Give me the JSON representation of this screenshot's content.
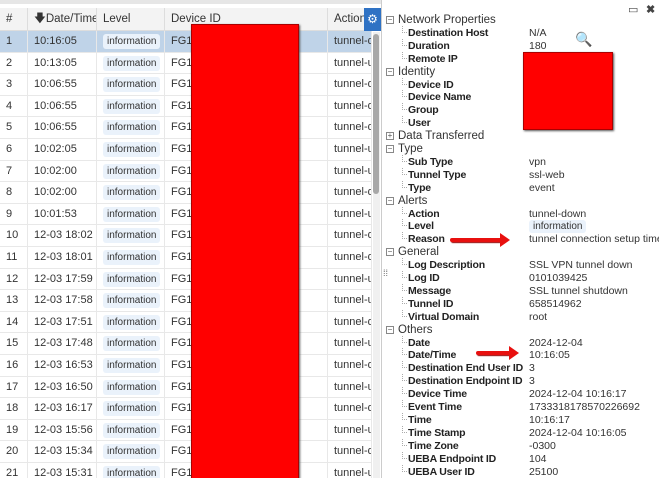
{
  "table": {
    "columns": [
      "#",
      "Date/Time",
      "Level",
      "Device ID",
      "Action"
    ],
    "sort_icon": "arrow-down-icon",
    "settings_icon": "gear-icon",
    "rows": [
      {
        "n": "1",
        "time": "10:16:05",
        "level": "information",
        "device": "FG1K",
        "action": "tunnel-down"
      },
      {
        "n": "2",
        "time": "10:13:05",
        "level": "information",
        "device": "FG1K",
        "action": "tunnel-up"
      },
      {
        "n": "3",
        "time": "10:06:55",
        "level": "information",
        "device": "FG1K",
        "action": "tunnel-down"
      },
      {
        "n": "4",
        "time": "10:06:55",
        "level": "information",
        "device": "FG1K",
        "action": "tunnel-down"
      },
      {
        "n": "5",
        "time": "10:06:55",
        "level": "information",
        "device": "FG1K",
        "action": "tunnel-down"
      },
      {
        "n": "6",
        "time": "10:02:05",
        "level": "information",
        "device": "FG1K",
        "action": "tunnel-up"
      },
      {
        "n": "7",
        "time": "10:02:00",
        "level": "information",
        "device": "FG1K",
        "action": "tunnel-up"
      },
      {
        "n": "8",
        "time": "10:02:00",
        "level": "information",
        "device": "FG1K",
        "action": "tunnel-down"
      },
      {
        "n": "9",
        "time": "10:01:53",
        "level": "information",
        "device": "FG1K",
        "action": "tunnel-up"
      },
      {
        "n": "10",
        "time": "12-03 18:02",
        "level": "information",
        "device": "FG1K",
        "action": "tunnel-down"
      },
      {
        "n": "11",
        "time": "12-03 18:01",
        "level": "information",
        "device": "FG1K",
        "action": "tunnel-down"
      },
      {
        "n": "12",
        "time": "12-03 17:59",
        "level": "information",
        "device": "FG1K",
        "action": "tunnel-up"
      },
      {
        "n": "13",
        "time": "12-03 17:58",
        "level": "information",
        "device": "FG1K",
        "action": "tunnel-up"
      },
      {
        "n": "14",
        "time": "12-03 17:51",
        "level": "information",
        "device": "FG1K",
        "action": "tunnel-down"
      },
      {
        "n": "15",
        "time": "12-03 17:48",
        "level": "information",
        "device": "FG1K",
        "action": "tunnel-up"
      },
      {
        "n": "16",
        "time": "12-03 16:53",
        "level": "information",
        "device": "FG1K",
        "action": "tunnel-down"
      },
      {
        "n": "17",
        "time": "12-03 16:50",
        "level": "information",
        "device": "FG1K",
        "action": "tunnel-up"
      },
      {
        "n": "18",
        "time": "12-03 16:17",
        "level": "information",
        "device": "FG1K",
        "action": "tunnel-down"
      },
      {
        "n": "19",
        "time": "12-03 15:56",
        "level": "information",
        "device": "FG1K",
        "action": "tunnel-up"
      },
      {
        "n": "20",
        "time": "12-03 15:34",
        "level": "information",
        "device": "FG1K",
        "action": "tunnel-down"
      },
      {
        "n": "21",
        "time": "12-03 15:31",
        "level": "information",
        "device": "FG1K",
        "action": "tunnel-up"
      }
    ]
  },
  "detail": {
    "window_icons": [
      "maximize-icon",
      "close-icon"
    ],
    "sections": [
      {
        "title": "Network Properties",
        "expanded": true,
        "fields": [
          [
            "Destination Host",
            "N/A"
          ],
          [
            "Duration",
            "180"
          ],
          [
            "Remote IP",
            ""
          ]
        ]
      },
      {
        "title": "Identity",
        "expanded": true,
        "fields": [
          [
            "Device ID",
            ""
          ],
          [
            "Device Name",
            ""
          ],
          [
            "Group",
            ""
          ],
          [
            "User",
            "ne"
          ]
        ]
      },
      {
        "title": "Data Transferred",
        "expanded": false,
        "fields": []
      },
      {
        "title": "Type",
        "expanded": true,
        "fields": [
          [
            "Sub Type",
            "vpn"
          ],
          [
            "Tunnel Type",
            "ssl-web"
          ],
          [
            "Type",
            "event"
          ]
        ]
      },
      {
        "title": "Alerts",
        "expanded": true,
        "fields": [
          [
            "Action",
            "tunnel-down"
          ],
          [
            "Level",
            "information"
          ],
          [
            "Reason",
            "tunnel connection setup timeout"
          ]
        ]
      },
      {
        "title": "General",
        "expanded": true,
        "fields": [
          [
            "Log Description",
            "SSL VPN tunnel down"
          ],
          [
            "Log ID",
            "0101039425"
          ],
          [
            "Message",
            "SSL tunnel shutdown"
          ],
          [
            "Tunnel ID",
            "658514962"
          ],
          [
            "Virtual Domain",
            "root"
          ]
        ]
      },
      {
        "title": "Others",
        "expanded": true,
        "fields": [
          [
            "Date",
            "2024-12-04"
          ],
          [
            "Date/Time",
            "10:16:05"
          ],
          [
            "Destination End User ID",
            "3"
          ],
          [
            "Destination Endpoint ID",
            "3"
          ],
          [
            "Device Time",
            "2024-12-04 10:16:17"
          ],
          [
            "Event Time",
            "1733318178570226692"
          ],
          [
            "Time",
            "10:16:17"
          ],
          [
            "Time Stamp",
            "2024-12-04 10:16:05"
          ],
          [
            "Time Zone",
            "-0300"
          ],
          [
            "UEBA Endpoint ID",
            "104"
          ],
          [
            "UEBA User ID",
            "25100"
          ]
        ]
      }
    ]
  },
  "colors": {
    "selected_row": "#bfd3e8",
    "accent": "#2f72c4",
    "badge": "#eaf2fb",
    "redaction": "#ff0000",
    "arrow": "#e8100f"
  }
}
